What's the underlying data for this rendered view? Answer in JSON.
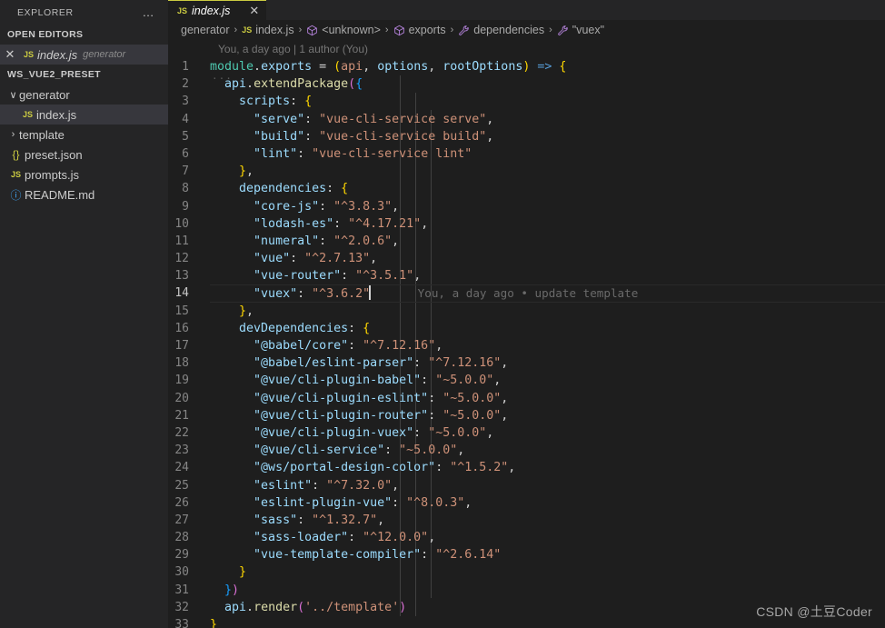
{
  "sidebar": {
    "title": "EXPLORER",
    "more_label": "…",
    "open_editors": {
      "header": "OPEN EDITORS",
      "items": [
        {
          "close": "✕",
          "icon": "js-file-icon",
          "icon_text": "JS",
          "name": "index.js",
          "description": "generator"
        }
      ]
    },
    "workspace": {
      "header": "WS_VUE2_PRESET",
      "items": [
        {
          "twisty": "∨",
          "icon": "folder-open-icon",
          "icon_text": "",
          "name": "generator",
          "indent": 1,
          "selected": false
        },
        {
          "twisty": "",
          "icon": "js-file-icon",
          "icon_text": "JS",
          "name": "index.js",
          "indent": 2,
          "selected": true
        },
        {
          "twisty": "›",
          "icon": "folder-closed-icon",
          "icon_text": "",
          "name": "template",
          "indent": 1,
          "selected": false
        },
        {
          "twisty": "",
          "icon": "json-file-icon",
          "icon_text": "{}",
          "name": "preset.json",
          "indent": 1,
          "selected": false
        },
        {
          "twisty": "",
          "icon": "js-file-icon",
          "icon_text": "JS",
          "name": "prompts.js",
          "indent": 1,
          "selected": false
        },
        {
          "twisty": "",
          "icon": "markdown-file-icon",
          "icon_text": "ⓘ",
          "name": "README.md",
          "indent": 1,
          "selected": false
        }
      ]
    }
  },
  "tabs": [
    {
      "icon_text": "JS",
      "label": "index.js",
      "close": "✕",
      "active": true,
      "preview": true
    }
  ],
  "breadcrumb": {
    "separator": "›",
    "segments": [
      {
        "icon": "none",
        "label": "generator"
      },
      {
        "icon": "js",
        "label": "index.js"
      },
      {
        "icon": "cube",
        "label": "<unknown>"
      },
      {
        "icon": "cube",
        "label": "exports"
      },
      {
        "icon": "wrench",
        "label": "dependencies"
      },
      {
        "icon": "wrench",
        "label": "\"vuex\""
      }
    ]
  },
  "blame_header": "You, a day ago | 1 author (You)",
  "inline_blame": {
    "line": 14,
    "text": "You, a day ago • update template"
  },
  "editor": {
    "cursor_line": 14,
    "lines": [
      {
        "n": 1,
        "tokens": [
          {
            "t": "module",
            "c": "t-green"
          },
          {
            "t": ".",
            "c": "t-punc"
          },
          {
            "t": "exports",
            "c": "t-var"
          },
          {
            "t": " = ",
            "c": "t-op"
          },
          {
            "t": "(",
            "c": "t-brkt-y"
          },
          {
            "t": "api",
            "c": "t-orange"
          },
          {
            "t": ", ",
            "c": "t-punc"
          },
          {
            "t": "options",
            "c": "t-param"
          },
          {
            "t": ", ",
            "c": "t-punc"
          },
          {
            "t": "rootOptions",
            "c": "t-param"
          },
          {
            "t": ")",
            "c": "t-brkt-y"
          },
          {
            "t": " => ",
            "c": "t-key"
          },
          {
            "t": "{",
            "c": "t-brkt-y"
          }
        ]
      },
      {
        "n": 2,
        "tokens": [
          {
            "t": "  ",
            "c": "t-punc"
          },
          {
            "t": "api",
            "c": "t-var"
          },
          {
            "t": ".",
            "c": "t-punc"
          },
          {
            "t": "extendPackage",
            "c": "t-fn"
          },
          {
            "t": "(",
            "c": "t-brkt-p"
          },
          {
            "t": "{",
            "c": "t-brkt-b"
          }
        ]
      },
      {
        "n": 3,
        "tokens": [
          {
            "t": "    ",
            "c": "t-punc"
          },
          {
            "t": "scripts",
            "c": "t-var"
          },
          {
            "t": ": ",
            "c": "t-punc"
          },
          {
            "t": "{",
            "c": "t-brkt-y"
          }
        ]
      },
      {
        "n": 4,
        "tokens": [
          {
            "t": "      ",
            "c": "t-punc"
          },
          {
            "t": "\"serve\"",
            "c": "t-var"
          },
          {
            "t": ": ",
            "c": "t-punc"
          },
          {
            "t": "\"vue-cli-service serve\"",
            "c": "t-str"
          },
          {
            "t": ",",
            "c": "t-punc"
          }
        ]
      },
      {
        "n": 5,
        "tokens": [
          {
            "t": "      ",
            "c": "t-punc"
          },
          {
            "t": "\"build\"",
            "c": "t-var"
          },
          {
            "t": ": ",
            "c": "t-punc"
          },
          {
            "t": "\"vue-cli-service build\"",
            "c": "t-str"
          },
          {
            "t": ",",
            "c": "t-punc"
          }
        ]
      },
      {
        "n": 6,
        "tokens": [
          {
            "t": "      ",
            "c": "t-punc"
          },
          {
            "t": "\"lint\"",
            "c": "t-var"
          },
          {
            "t": ": ",
            "c": "t-punc"
          },
          {
            "t": "\"vue-cli-service lint\"",
            "c": "t-str"
          }
        ]
      },
      {
        "n": 7,
        "tokens": [
          {
            "t": "    ",
            "c": "t-punc"
          },
          {
            "t": "}",
            "c": "t-brkt-y"
          },
          {
            "t": ",",
            "c": "t-punc"
          }
        ]
      },
      {
        "n": 8,
        "tokens": [
          {
            "t": "    ",
            "c": "t-punc"
          },
          {
            "t": "dependencies",
            "c": "t-var"
          },
          {
            "t": ": ",
            "c": "t-punc"
          },
          {
            "t": "{",
            "c": "t-brkt-y"
          }
        ]
      },
      {
        "n": 9,
        "tokens": [
          {
            "t": "      ",
            "c": "t-punc"
          },
          {
            "t": "\"core-js\"",
            "c": "t-var"
          },
          {
            "t": ": ",
            "c": "t-punc"
          },
          {
            "t": "\"^3.8.3\"",
            "c": "t-str"
          },
          {
            "t": ",",
            "c": "t-punc"
          }
        ]
      },
      {
        "n": 10,
        "tokens": [
          {
            "t": "      ",
            "c": "t-punc"
          },
          {
            "t": "\"lodash-es\"",
            "c": "t-var"
          },
          {
            "t": ": ",
            "c": "t-punc"
          },
          {
            "t": "\"^4.17.21\"",
            "c": "t-str"
          },
          {
            "t": ",",
            "c": "t-punc"
          }
        ]
      },
      {
        "n": 11,
        "tokens": [
          {
            "t": "      ",
            "c": "t-punc"
          },
          {
            "t": "\"numeral\"",
            "c": "t-var"
          },
          {
            "t": ": ",
            "c": "t-punc"
          },
          {
            "t": "\"^2.0.6\"",
            "c": "t-str"
          },
          {
            "t": ",",
            "c": "t-punc"
          }
        ]
      },
      {
        "n": 12,
        "tokens": [
          {
            "t": "      ",
            "c": "t-punc"
          },
          {
            "t": "\"vue\"",
            "c": "t-var"
          },
          {
            "t": ": ",
            "c": "t-punc"
          },
          {
            "t": "\"^2.7.13\"",
            "c": "t-str"
          },
          {
            "t": ",",
            "c": "t-punc"
          }
        ]
      },
      {
        "n": 13,
        "tokens": [
          {
            "t": "      ",
            "c": "t-punc"
          },
          {
            "t": "\"vue-router\"",
            "c": "t-var"
          },
          {
            "t": ": ",
            "c": "t-punc"
          },
          {
            "t": "\"^3.5.1\"",
            "c": "t-str"
          },
          {
            "t": ",",
            "c": "t-punc"
          }
        ]
      },
      {
        "n": 14,
        "tokens": [
          {
            "t": "      ",
            "c": "t-punc"
          },
          {
            "t": "\"vuex\"",
            "c": "t-var"
          },
          {
            "t": ": ",
            "c": "t-punc"
          },
          {
            "t": "\"^3.6.2\"",
            "c": "t-str"
          }
        ]
      },
      {
        "n": 15,
        "tokens": [
          {
            "t": "    ",
            "c": "t-punc"
          },
          {
            "t": "}",
            "c": "t-brkt-y"
          },
          {
            "t": ",",
            "c": "t-punc"
          }
        ]
      },
      {
        "n": 16,
        "tokens": [
          {
            "t": "    ",
            "c": "t-punc"
          },
          {
            "t": "devDependencies",
            "c": "t-var"
          },
          {
            "t": ": ",
            "c": "t-punc"
          },
          {
            "t": "{",
            "c": "t-brkt-y"
          }
        ]
      },
      {
        "n": 17,
        "tokens": [
          {
            "t": "      ",
            "c": "t-punc"
          },
          {
            "t": "\"@babel/core\"",
            "c": "t-var"
          },
          {
            "t": ": ",
            "c": "t-punc"
          },
          {
            "t": "\"^7.12.16\"",
            "c": "t-str"
          },
          {
            "t": ",",
            "c": "t-punc"
          }
        ]
      },
      {
        "n": 18,
        "tokens": [
          {
            "t": "      ",
            "c": "t-punc"
          },
          {
            "t": "\"@babel/eslint-parser\"",
            "c": "t-var"
          },
          {
            "t": ": ",
            "c": "t-punc"
          },
          {
            "t": "\"^7.12.16\"",
            "c": "t-str"
          },
          {
            "t": ",",
            "c": "t-punc"
          }
        ]
      },
      {
        "n": 19,
        "tokens": [
          {
            "t": "      ",
            "c": "t-punc"
          },
          {
            "t": "\"@vue/cli-plugin-babel\"",
            "c": "t-var"
          },
          {
            "t": ": ",
            "c": "t-punc"
          },
          {
            "t": "\"~5.0.0\"",
            "c": "t-str"
          },
          {
            "t": ",",
            "c": "t-punc"
          }
        ]
      },
      {
        "n": 20,
        "tokens": [
          {
            "t": "      ",
            "c": "t-punc"
          },
          {
            "t": "\"@vue/cli-plugin-eslint\"",
            "c": "t-var"
          },
          {
            "t": ": ",
            "c": "t-punc"
          },
          {
            "t": "\"~5.0.0\"",
            "c": "t-str"
          },
          {
            "t": ",",
            "c": "t-punc"
          }
        ]
      },
      {
        "n": 21,
        "tokens": [
          {
            "t": "      ",
            "c": "t-punc"
          },
          {
            "t": "\"@vue/cli-plugin-router\"",
            "c": "t-var"
          },
          {
            "t": ": ",
            "c": "t-punc"
          },
          {
            "t": "\"~5.0.0\"",
            "c": "t-str"
          },
          {
            "t": ",",
            "c": "t-punc"
          }
        ]
      },
      {
        "n": 22,
        "tokens": [
          {
            "t": "      ",
            "c": "t-punc"
          },
          {
            "t": "\"@vue/cli-plugin-vuex\"",
            "c": "t-var"
          },
          {
            "t": ": ",
            "c": "t-punc"
          },
          {
            "t": "\"~5.0.0\"",
            "c": "t-str"
          },
          {
            "t": ",",
            "c": "t-punc"
          }
        ]
      },
      {
        "n": 23,
        "tokens": [
          {
            "t": "      ",
            "c": "t-punc"
          },
          {
            "t": "\"@vue/cli-service\"",
            "c": "t-var"
          },
          {
            "t": ": ",
            "c": "t-punc"
          },
          {
            "t": "\"~5.0.0\"",
            "c": "t-str"
          },
          {
            "t": ",",
            "c": "t-punc"
          }
        ]
      },
      {
        "n": 24,
        "tokens": [
          {
            "t": "      ",
            "c": "t-punc"
          },
          {
            "t": "\"@ws/portal-design-color\"",
            "c": "t-var"
          },
          {
            "t": ": ",
            "c": "t-punc"
          },
          {
            "t": "\"^1.5.2\"",
            "c": "t-str"
          },
          {
            "t": ",",
            "c": "t-punc"
          }
        ]
      },
      {
        "n": 25,
        "tokens": [
          {
            "t": "      ",
            "c": "t-punc"
          },
          {
            "t": "\"eslint\"",
            "c": "t-var"
          },
          {
            "t": ": ",
            "c": "t-punc"
          },
          {
            "t": "\"^7.32.0\"",
            "c": "t-str"
          },
          {
            "t": ",",
            "c": "t-punc"
          }
        ]
      },
      {
        "n": 26,
        "tokens": [
          {
            "t": "      ",
            "c": "t-punc"
          },
          {
            "t": "\"eslint-plugin-vue\"",
            "c": "t-var"
          },
          {
            "t": ": ",
            "c": "t-punc"
          },
          {
            "t": "\"^8.0.3\"",
            "c": "t-str"
          },
          {
            "t": ",",
            "c": "t-punc"
          }
        ]
      },
      {
        "n": 27,
        "tokens": [
          {
            "t": "      ",
            "c": "t-punc"
          },
          {
            "t": "\"sass\"",
            "c": "t-var"
          },
          {
            "t": ": ",
            "c": "t-punc"
          },
          {
            "t": "\"^1.32.7\"",
            "c": "t-str"
          },
          {
            "t": ",",
            "c": "t-punc"
          }
        ]
      },
      {
        "n": 28,
        "tokens": [
          {
            "t": "      ",
            "c": "t-punc"
          },
          {
            "t": "\"sass-loader\"",
            "c": "t-var"
          },
          {
            "t": ": ",
            "c": "t-punc"
          },
          {
            "t": "\"^12.0.0\"",
            "c": "t-str"
          },
          {
            "t": ",",
            "c": "t-punc"
          }
        ]
      },
      {
        "n": 29,
        "tokens": [
          {
            "t": "      ",
            "c": "t-punc"
          },
          {
            "t": "\"vue-template-compiler\"",
            "c": "t-var"
          },
          {
            "t": ": ",
            "c": "t-punc"
          },
          {
            "t": "\"^2.6.14\"",
            "c": "t-str"
          }
        ]
      },
      {
        "n": 30,
        "tokens": [
          {
            "t": "    ",
            "c": "t-punc"
          },
          {
            "t": "}",
            "c": "t-brkt-y"
          }
        ]
      },
      {
        "n": 31,
        "tokens": [
          {
            "t": "  ",
            "c": "t-punc"
          },
          {
            "t": "}",
            "c": "t-brkt-b"
          },
          {
            "t": ")",
            "c": "t-brkt-p"
          }
        ]
      },
      {
        "n": 32,
        "tokens": [
          {
            "t": "  ",
            "c": "t-punc"
          },
          {
            "t": "api",
            "c": "t-var"
          },
          {
            "t": ".",
            "c": "t-punc"
          },
          {
            "t": "render",
            "c": "t-fn"
          },
          {
            "t": "(",
            "c": "t-brkt-p"
          },
          {
            "t": "'../template'",
            "c": "t-str"
          },
          {
            "t": ")",
            "c": "t-brkt-p"
          }
        ]
      },
      {
        "n": 33,
        "tokens": [
          {
            "t": "",
            "c": "t-punc"
          },
          {
            "t": "}",
            "c": "t-brkt-y"
          }
        ]
      }
    ]
  },
  "watermark": "CSDN @土豆Coder",
  "colors": {
    "sidebar_bg": "#252526",
    "editor_bg": "#1e1e1e",
    "selection_bg": "#37373d",
    "tab_accent": "#cbcb41",
    "string": "#ce9178",
    "variable": "#9cdcfe",
    "function": "#dcdcaa",
    "keyword": "#569cd6",
    "linenumber": "#858585"
  }
}
